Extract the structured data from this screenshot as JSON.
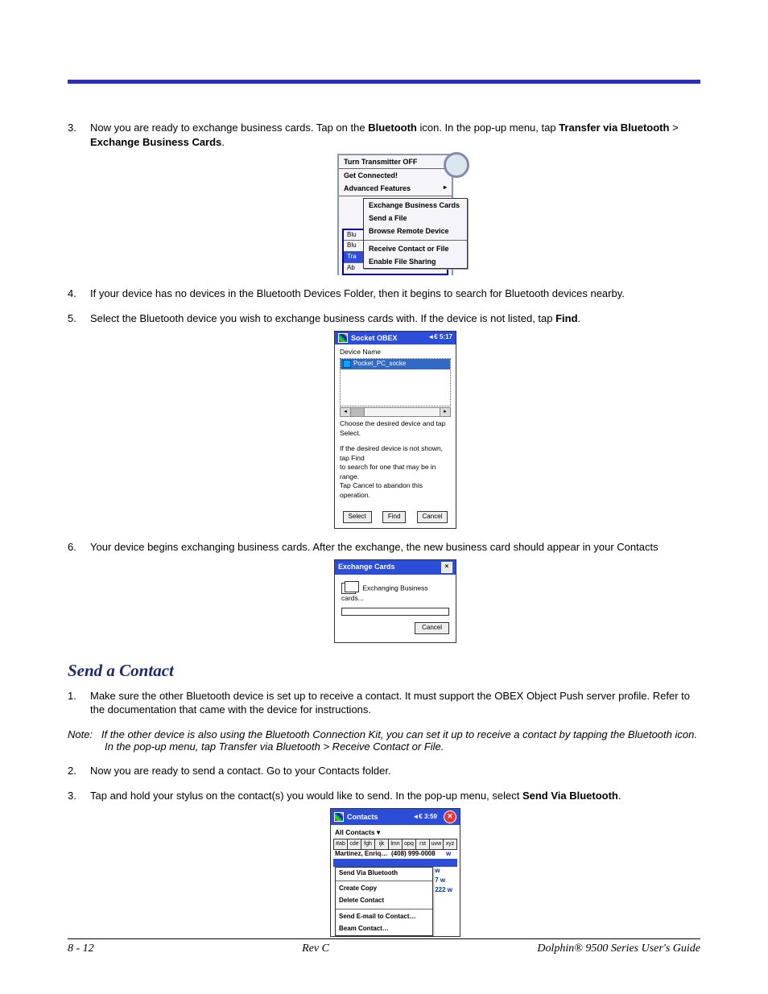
{
  "steps_a": {
    "s3": {
      "num": "3.",
      "text_pre": "Now you are ready to exchange business cards. Tap on the ",
      "b1": "Bluetooth",
      "text_mid": " icon. In the pop-up menu, tap ",
      "b2": "Transfer via Bluetooth",
      "gt": " > ",
      "b3": "Exchange Business Cards",
      "text_post": "."
    },
    "s4": {
      "num": "4.",
      "text": "If your device has no devices in the Bluetooth Devices Folder, then it begins to search for Bluetooth devices nearby."
    },
    "s5": {
      "num": "5.",
      "text_pre": "Select the Bluetooth device you wish to exchange business cards with. If the device is not listed, tap ",
      "b1": "Find",
      "text_post": "."
    },
    "s6": {
      "num": "6.",
      "text": "Your device begins exchanging business cards. After the exchange, the new business card should appear in your Contacts"
    }
  },
  "fig1": {
    "r1": "Turn Transmitter OFF",
    "r2": "Get Connected!",
    "r3": "Advanced Features",
    "side1": "Blu",
    "side2": "Blu",
    "side3": "Tra",
    "side4": "Ab",
    "sub1": "Exchange Business Cards",
    "sub2": "Send a File",
    "sub3": "Browse Remote Device",
    "sub4": "Receive Contact or File",
    "sub5": "Enable File Sharing"
  },
  "fig2": {
    "title": "Socket OBEX",
    "time": "◄€ 5:17",
    "label": "Device Name",
    "device": "Pocket_PC_socke",
    "hint1": "Choose the desired device and tap Select.",
    "hint2a": "If the desired device is not shown, tap Find",
    "hint2b": "to search for one that may be in range.",
    "hint2c": "Tap Cancel to abandon this operation.",
    "btn1": "Select",
    "btn2": "Find",
    "btn3": "Cancel"
  },
  "fig3": {
    "title": "Exchange Cards",
    "msg": "Exchanging Business cards...",
    "btn": "Cancel",
    "close": "×"
  },
  "section_title": "Send a Contact",
  "steps_b": {
    "s1": {
      "num": "1.",
      "text": "Make sure the other Bluetooth device is set up to receive a contact. It must support the OBEX Object Push server profile. Refer to the documentation that came with the device for instructions."
    },
    "s2": {
      "num": "2.",
      "text": "Now you are ready to send a contact. Go to your Contacts folder."
    },
    "s3": {
      "num": "3.",
      "text_pre": "Tap and hold your stylus on the contact(s) you would like to send. In the pop-up menu, select ",
      "b1": "Send Via Bluetooth",
      "text_post": "."
    }
  },
  "note": {
    "label": "Note:",
    "text": "If the other device is also using the Bluetooth Connection Kit, you can set it up to receive a contact by tapping the Bluetooth icon. In the pop-up menu, tap Transfer via Bluetooth > Receive Contact or File."
  },
  "fig4": {
    "title": "Contacts",
    "time": "◄€ 3:59",
    "close": "✕",
    "combo": "All Contacts ▾",
    "alpha": [
      "#ab",
      "cde",
      "fgh",
      "ijk",
      "lmn",
      "opq",
      "rst",
      "uvw",
      "xyz"
    ],
    "row1": {
      "c1": "Martinez, Enriq…",
      "c2": "(408) 999-0008",
      "c3": "w"
    },
    "right": [
      "w",
      "7    w",
      "222  w"
    ],
    "ctx": [
      "Send Via Bluetooth",
      "Create Copy",
      "Delete Contact",
      "Send E-mail to Contact…",
      "Beam Contact…"
    ]
  },
  "footer": {
    "left": "8 - 12",
    "center": "Rev C",
    "right": "Dolphin® 9500 Series User's Guide"
  }
}
